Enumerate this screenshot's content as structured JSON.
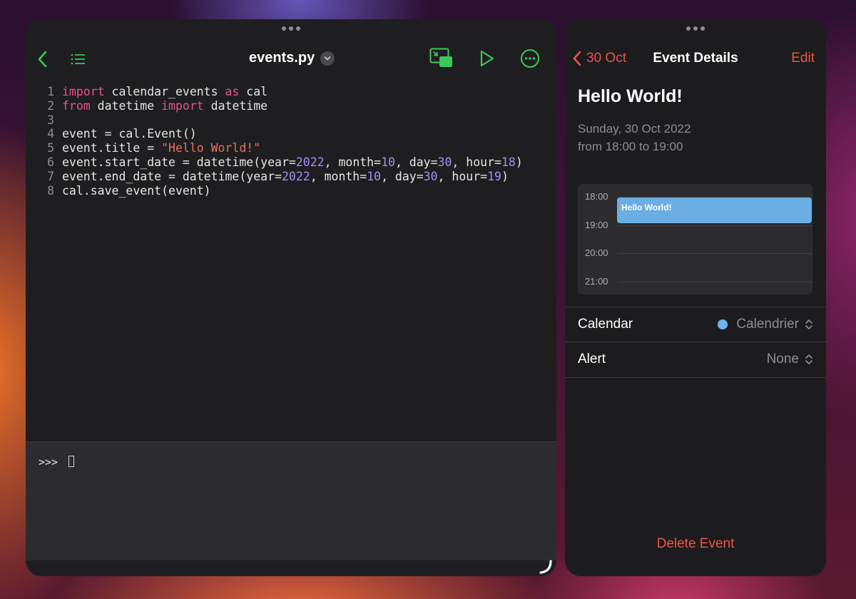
{
  "colors": {
    "accent_green": "#3cc75a",
    "accent_red": "#eb5545",
    "keyword": "#e8528e",
    "string": "#f06e5c",
    "number": "#a88cf0",
    "event_block": "#6aaee3",
    "calendar_dot": "#6fb3f2"
  },
  "editor": {
    "filename": "events.py",
    "toolbar_icons": [
      "back-chevron-icon",
      "list-icon",
      "chevron-down-icon",
      "picture-in-picture-icon",
      "play-icon",
      "more-ellipsis-icon"
    ],
    "code_lines": [
      [
        {
          "t": "import",
          "c": "kw"
        },
        {
          "t": " calendar_events "
        },
        {
          "t": "as",
          "c": "kw"
        },
        {
          "t": " cal"
        }
      ],
      [
        {
          "t": "from",
          "c": "kw"
        },
        {
          "t": " datetime "
        },
        {
          "t": "import",
          "c": "kw"
        },
        {
          "t": " datetime"
        }
      ],
      [],
      [
        {
          "t": "event = cal.Event()"
        }
      ],
      [
        {
          "t": "event.title = "
        },
        {
          "t": "\"Hello World!\"",
          "c": "str"
        }
      ],
      [
        {
          "t": "event.start_date = datetime(year="
        },
        {
          "t": "2022",
          "c": "num"
        },
        {
          "t": ", month="
        },
        {
          "t": "10",
          "c": "num"
        },
        {
          "t": ", day="
        },
        {
          "t": "30",
          "c": "num"
        },
        {
          "t": ", hour="
        },
        {
          "t": "18",
          "c": "num"
        },
        {
          "t": ")"
        }
      ],
      [
        {
          "t": "event.end_date = datetime(year="
        },
        {
          "t": "2022",
          "c": "num"
        },
        {
          "t": ", month="
        },
        {
          "t": "10",
          "c": "num"
        },
        {
          "t": ", day="
        },
        {
          "t": "30",
          "c": "num"
        },
        {
          "t": ", hour="
        },
        {
          "t": "19",
          "c": "num"
        },
        {
          "t": ")"
        }
      ],
      [
        {
          "t": "cal.save_event(event)"
        }
      ]
    ],
    "console_prompt": ">>>"
  },
  "calendar": {
    "back_label": "30 Oct",
    "nav_title": "Event Details",
    "edit_label": "Edit",
    "event_title": "Hello World!",
    "event_date": "Sunday, 30 Oct 2022",
    "event_time": "from 18:00 to 19:00",
    "timeline": {
      "hours": [
        "18:00",
        "19:00",
        "20:00",
        "21:00"
      ],
      "event_label": "Hello World!"
    },
    "rows": {
      "calendar_label": "Calendar",
      "calendar_value": "Calendrier",
      "alert_label": "Alert",
      "alert_value": "None"
    },
    "delete_label": "Delete Event"
  }
}
